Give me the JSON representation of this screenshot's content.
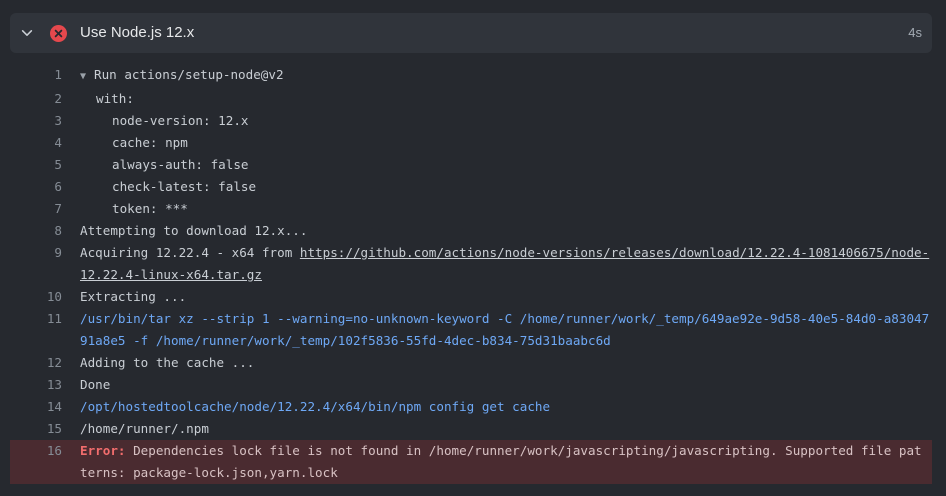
{
  "step": {
    "title": "Use Node.js 12.x",
    "duration": "4s",
    "status": "failed",
    "status_color": "#e5484d",
    "chevron_icon": "chevron-down-icon",
    "status_icon": "x-circle-icon"
  },
  "log": {
    "lines": [
      {
        "no": "1",
        "prefix": "▼",
        "text": "Run actions/setup-node@v2"
      },
      {
        "no": "2",
        "text": "with:"
      },
      {
        "no": "3",
        "text": "node-version: 12.x"
      },
      {
        "no": "4",
        "text": "cache: npm"
      },
      {
        "no": "5",
        "text": "always-auth: false"
      },
      {
        "no": "6",
        "text": "check-latest: false"
      },
      {
        "no": "7",
        "text": "token: ***"
      },
      {
        "no": "8",
        "text": "Attempting to download 12.x..."
      },
      {
        "no": "9",
        "text": "Acquiring 12.22.4 - x64 from ",
        "link": "https://github.com/actions/node-versions/releases/download/12.22.4-1081406675/node-12.22.4-linux-x64.tar.gz"
      },
      {
        "no": "10",
        "text": "Extracting ..."
      },
      {
        "no": "11",
        "text": "/usr/bin/tar xz --strip 1 --warning=no-unknown-keyword -C /home/runner/work/_temp/649ae92e-9d58-40e5-84d0-a8304791a8e5 -f /home/runner/work/_temp/102f5836-55fd-4dec-b834-75d31baabc6d"
      },
      {
        "no": "12",
        "text": "Adding to the cache ..."
      },
      {
        "no": "13",
        "text": "Done"
      },
      {
        "no": "14",
        "text": "/opt/hostedtoolcache/node/12.22.4/x64/bin/npm config get cache"
      },
      {
        "no": "15",
        "text": "/home/runner/.npm"
      },
      {
        "no": "16",
        "label": "Error:",
        "text": " Dependencies lock file is not found in /home/runner/work/javascripting/javascripting. Supported file patterns: package-lock.json,yarn.lock"
      }
    ]
  }
}
